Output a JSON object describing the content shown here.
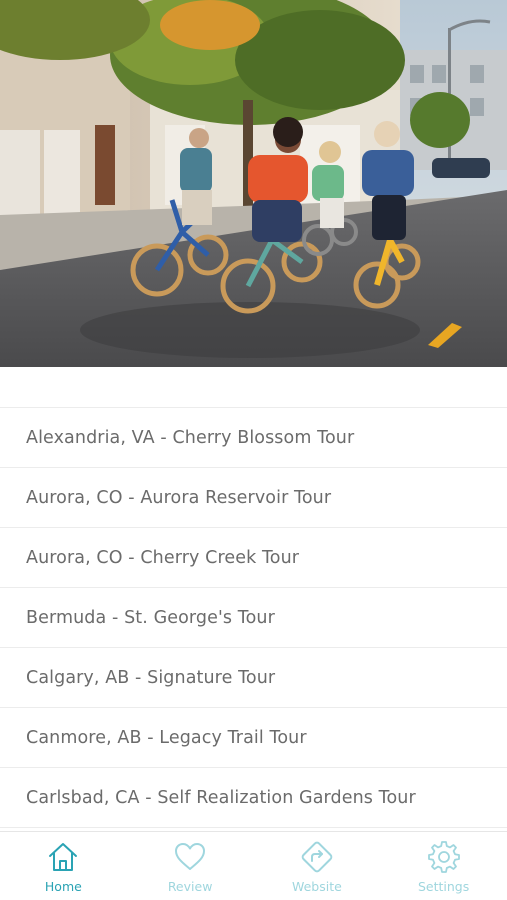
{
  "colors": {
    "accent": "#2aa3b4",
    "inactive": "#9fd6de",
    "list_text": "#6b6b6b",
    "divider": "#ececec"
  },
  "hero": {
    "image": "group-riding-electric-bikes-photo"
  },
  "tours": [
    {
      "label": "Alexandria, VA - Cherry Blossom Tour"
    },
    {
      "label": "Aurora, CO - Aurora Reservoir Tour"
    },
    {
      "label": "Aurora, CO - Cherry Creek Tour"
    },
    {
      "label": "Bermuda - St. George's Tour"
    },
    {
      "label": "Calgary, AB - Signature Tour"
    },
    {
      "label": "Canmore, AB - Legacy Trail Tour"
    },
    {
      "label": "Carlsbad, CA - Self Realization Gardens Tour"
    }
  ],
  "tabbar": {
    "tabs": [
      {
        "label": "Home",
        "icon": "home-icon",
        "active": true
      },
      {
        "label": "Review",
        "icon": "heart-icon",
        "active": false
      },
      {
        "label": "Website",
        "icon": "share-arrow-icon",
        "active": false
      },
      {
        "label": "Settings",
        "icon": "gear-icon",
        "active": false
      }
    ]
  }
}
